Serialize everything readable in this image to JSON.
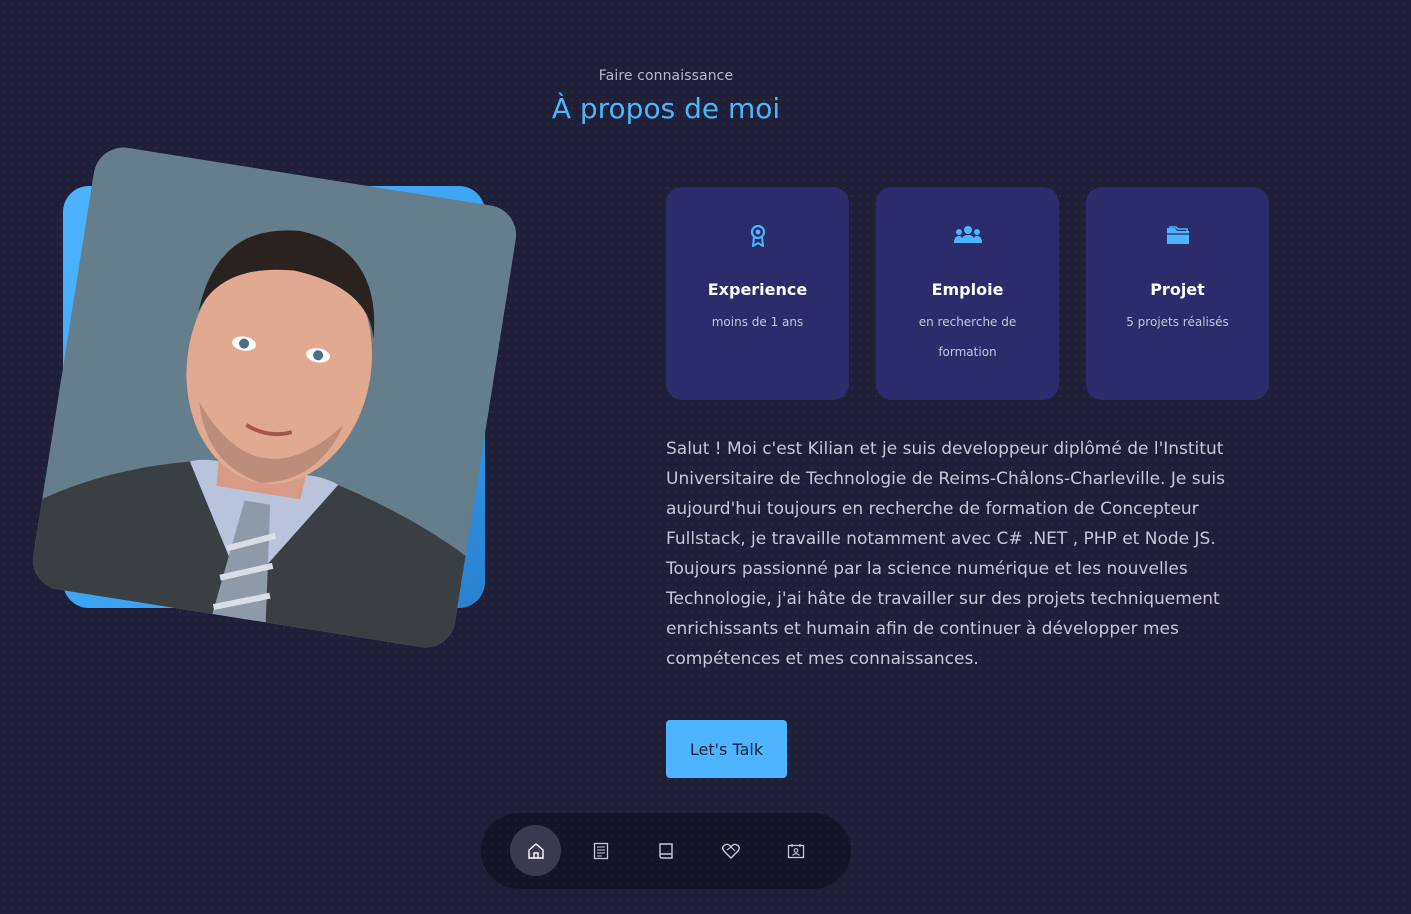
{
  "header": {
    "subtitle": "Faire connaissance",
    "title": "À propos de moi"
  },
  "photo": {
    "accent_color": "#4db5ff"
  },
  "cards": [
    {
      "icon": "award-icon",
      "title": "Experience",
      "text": "moins de 1 ans"
    },
    {
      "icon": "users-icon",
      "title": "Emploie",
      "text": "en recherche de formation"
    },
    {
      "icon": "folder-icon",
      "title": "Projet",
      "text": "5 projets réalisés"
    }
  ],
  "about": {
    "text": "Salut ! Moi c'est Kilian et je suis developpeur diplômé de l'Institut Universitaire de Technologie de Reims-Châlons-Charleville. Je suis aujourd'hui toujours en recherche de formation de Concepteur Fullstack, je travaille notamment avec C# .NET , PHP et Node JS. Toujours passionné par la science numérique et les nouvelles Technologie, j'ai hâte de travailler sur des projets techniquement enrichissants et humain afin de continuer à développer mes compétences et mes connaissances."
  },
  "cta": {
    "label": "Let's Talk"
  },
  "nav": {
    "items": [
      {
        "icon": "home-icon",
        "active": true
      },
      {
        "icon": "document-icon",
        "active": false
      },
      {
        "icon": "book-icon",
        "active": false
      },
      {
        "icon": "heart-handshake-icon",
        "active": false
      },
      {
        "icon": "contact-card-icon",
        "active": false
      }
    ]
  },
  "colors": {
    "background": "#1f1f38",
    "primary": "#4db5ff",
    "card": "#2c2c6c",
    "text_light": "#c7c7d6"
  }
}
